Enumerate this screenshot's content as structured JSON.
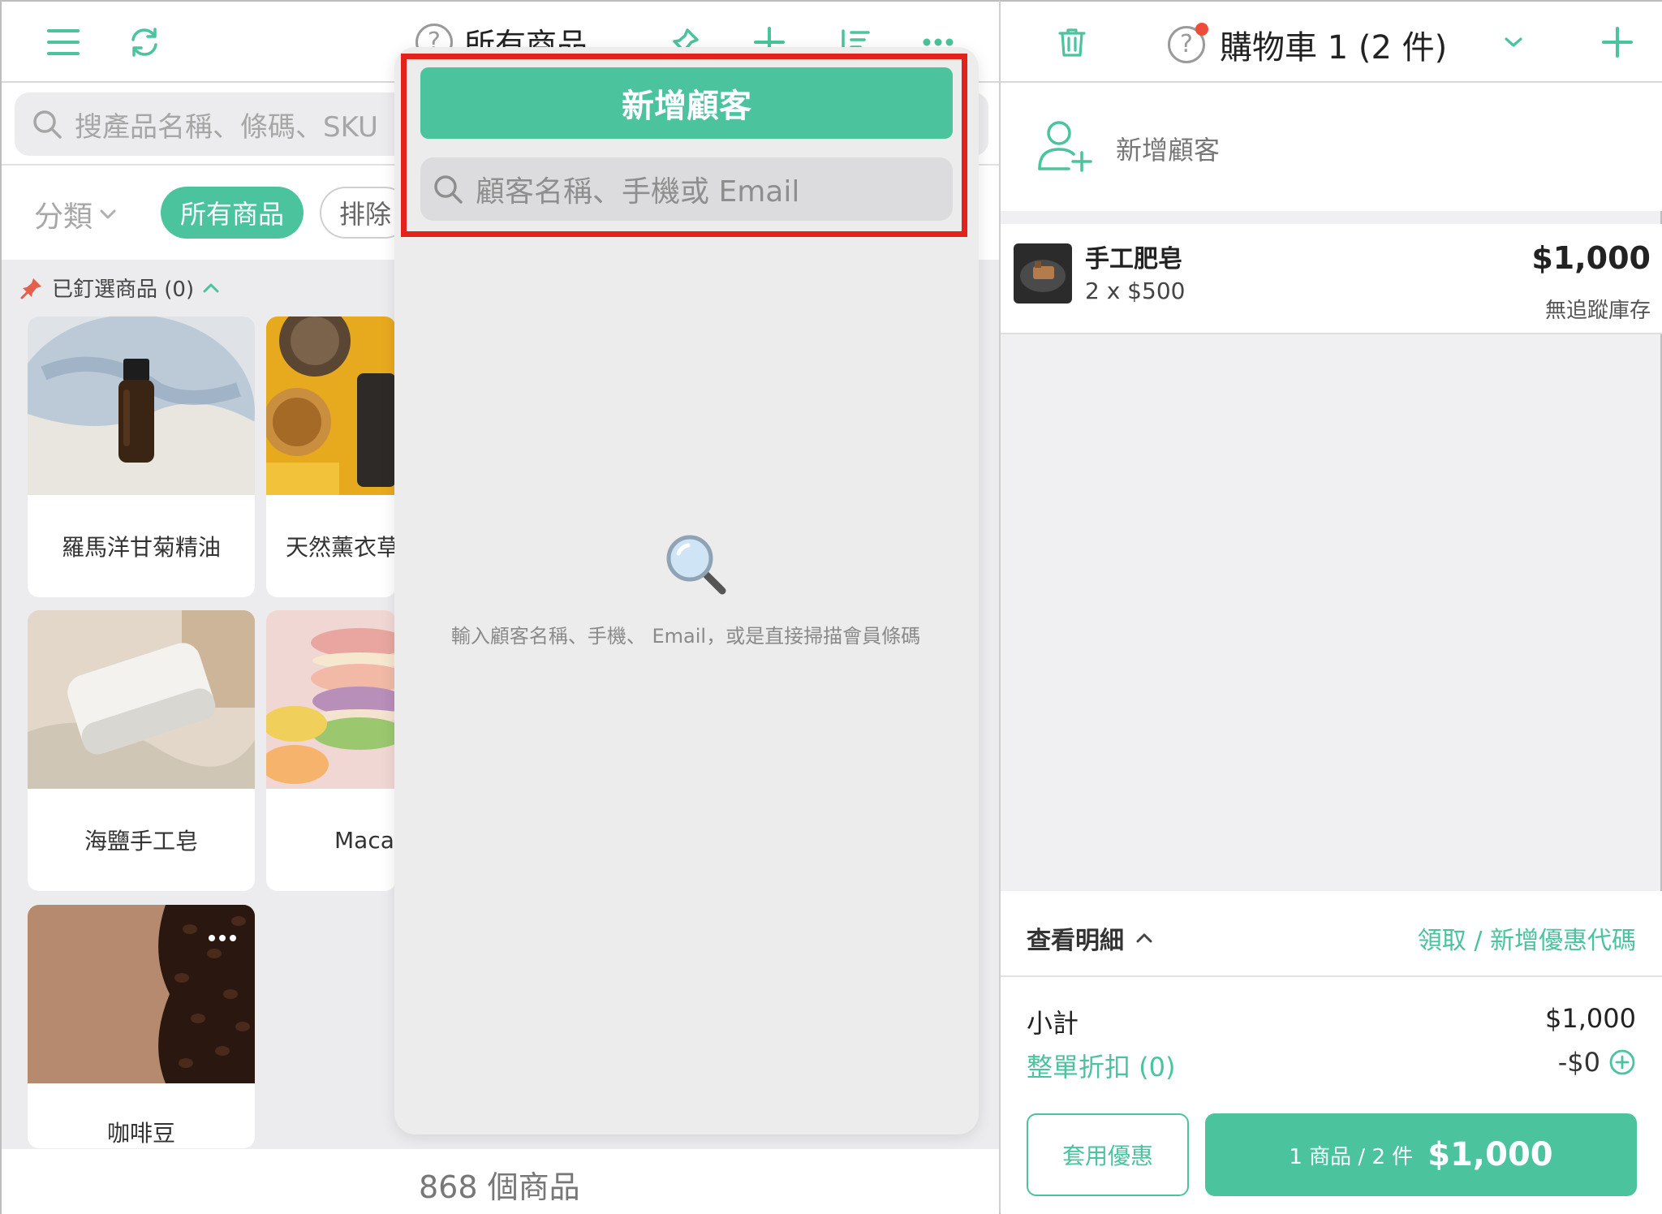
{
  "left_header": {
    "title": "所有商品",
    "icons": [
      "menu-icon",
      "refresh-icon",
      "help-icon",
      "pin-icon",
      "plus-icon",
      "sort-icon",
      "more-icon"
    ]
  },
  "product_search": {
    "placeholder": "搜產品名稱、條碼、SKU"
  },
  "filters": {
    "category_label": "分類",
    "active_chip": "所有商品",
    "other_chip": "排除"
  },
  "pinned": {
    "label": "已釘選商品 (0)"
  },
  "products": [
    {
      "name": "羅馬洋甘菊精油"
    },
    {
      "name": "天然薰衣草"
    },
    {
      "name": "海鹽手工皂"
    },
    {
      "name": "Macar"
    },
    {
      "name": "咖啡豆"
    }
  ],
  "footer": {
    "product_count": "868 個商品"
  },
  "customer_popup": {
    "add_button": "新增顧客",
    "search_placeholder": "顧客名稱、手機或 Email",
    "empty_hint": "輸入顧客名稱、手機、 Email，或是直接掃描會員條碼"
  },
  "cart": {
    "title": "購物車 1 (2 件)",
    "customer_label": "新增顧客",
    "item": {
      "name": "手工肥皂",
      "qty": "2 x $500",
      "price": "$1,000",
      "stock": "無追蹤庫存"
    },
    "summary": {
      "details_label": "查看明細",
      "coupon_link": "領取 / 新增優惠代碼",
      "subtotal_label": "小計",
      "subtotal_value": "$1,000",
      "discount_label": "整單折扣 (0)",
      "discount_value": "-$0"
    },
    "apply_discount": "套用優惠",
    "checkout_count": "1 商品 / 2 件",
    "checkout_amount": "$1,000"
  },
  "colors": {
    "accent": "#4bc39c",
    "highlight": "#e3231b",
    "notification": "#ef4b38"
  }
}
